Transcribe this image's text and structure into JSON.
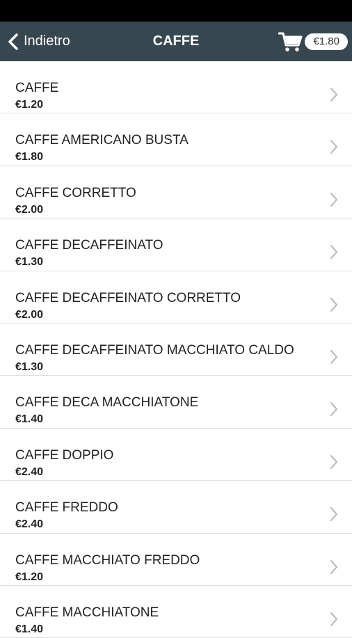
{
  "header": {
    "back_label": "Indietro",
    "title": "CAFFE",
    "cart_total": "€1.80"
  },
  "icons": {
    "back": "chevron-left-icon",
    "cart": "shopping-cart-icon",
    "row": "chevron-right-icon"
  },
  "colors": {
    "nav_background": "#37474f",
    "status_bar": "#000000",
    "divider": "#dedede"
  },
  "products": [
    {
      "name": "CAFFE",
      "price": "€1.20"
    },
    {
      "name": "CAFFE AMERICANO BUSTA",
      "price": "€1.80"
    },
    {
      "name": "CAFFE CORRETTO",
      "price": "€2.00"
    },
    {
      "name": "CAFFE DECAFFEINATO",
      "price": "€1.30"
    },
    {
      "name": "CAFFE DECAFFEINATO CORRETTO",
      "price": "€2.00"
    },
    {
      "name": "CAFFE DECAFFEINATO MACCHIATO CALDO",
      "price": "€1.30"
    },
    {
      "name": "CAFFE DECA MACCHIATONE",
      "price": "€1.40"
    },
    {
      "name": "CAFFE DOPPIO",
      "price": "€2.40"
    },
    {
      "name": "CAFFE FREDDO",
      "price": "€2.40"
    },
    {
      "name": "CAFFE MACCHIATO FREDDO",
      "price": "€1.20"
    },
    {
      "name": "CAFFE MACCHIATONE",
      "price": "€1.40"
    }
  ]
}
